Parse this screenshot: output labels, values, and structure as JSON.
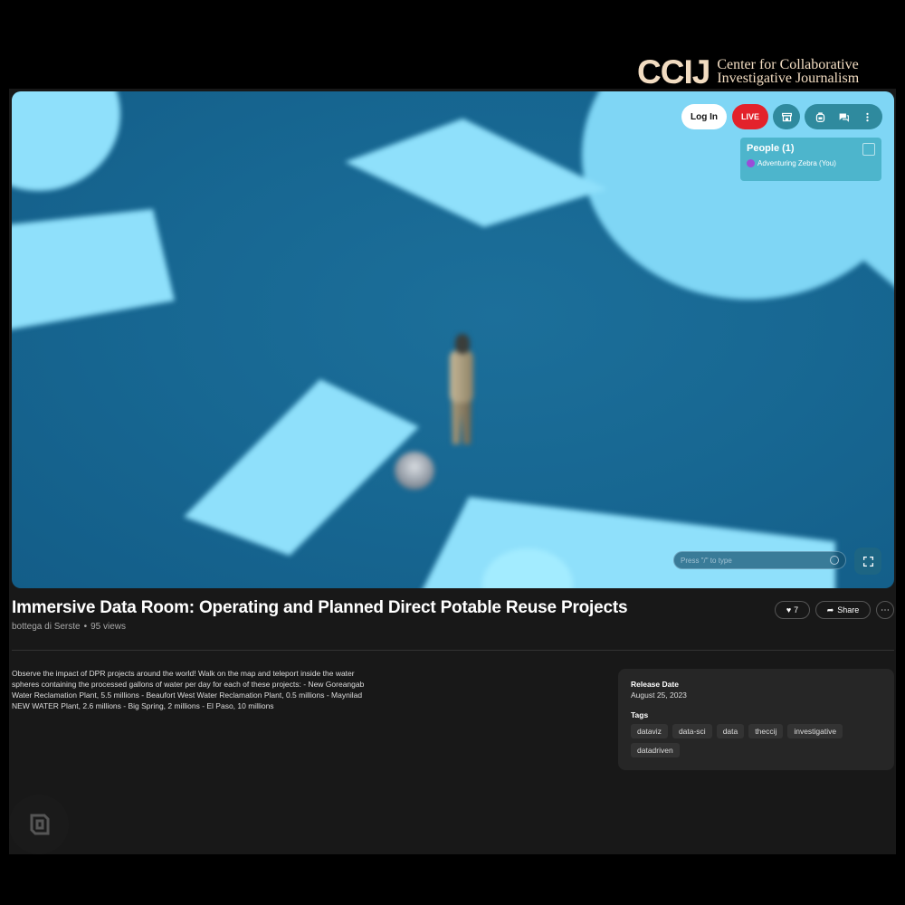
{
  "branding": {
    "mark": "CCIJ",
    "line1": "Center for Collaborative",
    "line2": "Investigative Journalism",
    "color": "#f2dcc1"
  },
  "viewport": {
    "login_label": "Log In",
    "live_label": "LIVE",
    "people": {
      "title": "People (1)",
      "members": [
        {
          "name": "Adventuring Zebra (You)",
          "color": "#9b4dd8"
        }
      ]
    },
    "chat_placeholder": "Press \"/\" to type",
    "icons": [
      "store-icon",
      "backpack-icon",
      "chat-icon",
      "more-vertical-icon",
      "fullscreen-icon",
      "emoji-icon"
    ]
  },
  "video": {
    "title": "Immersive Data Room: Operating and Planned Direct Potable Reuse Projects",
    "author": "bottega di Serste",
    "views": "95 views",
    "likes": "7",
    "share_label": "Share",
    "description": "Observe the impact of DPR projects around the world! Walk on the map and teleport inside the water spheres containing the processed gallons of water per day for each of these projects: - New Goreangab Water Reclamation Plant, 5.5 millions - Beaufort West Water Reclamation Plant, 0.5 millions - Maynilad NEW WATER Plant, 2.6 millions - Big Spring, 2 millions - El Paso, 10 millions"
  },
  "info": {
    "release_label": "Release Date",
    "release_date": "August 25, 2023",
    "tags_label": "Tags",
    "tags": [
      "dataviz",
      "data-sci",
      "data",
      "theccij",
      "investigative",
      "datadriven"
    ]
  },
  "colors": {
    "live": "#e3222b",
    "accent": "#2f8a9e",
    "scene": "#176792"
  }
}
